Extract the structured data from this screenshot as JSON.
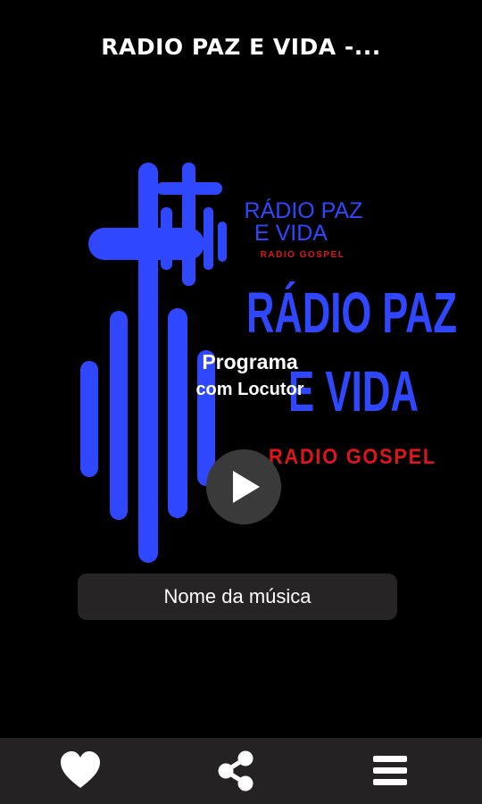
{
  "header": {
    "title": "RADIO PAZ E VIDA -..."
  },
  "logo": {
    "line1": "RÁDIO PAZ",
    "line2": "E VIDA",
    "tagline_small": "RADIO GOSPEL",
    "big_line1": "RÁDIO PAZ",
    "big_line2": "E VIDA",
    "tagline_big": "RADIO GOSPEL",
    "colors": {
      "brand_blue": "#2f47ff",
      "gospel_red": "#e0141b"
    }
  },
  "program": {
    "line1": "Programa",
    "line2": "com Locutor"
  },
  "player": {
    "play_icon": "play-icon",
    "song_name": "Nome da música"
  },
  "bottom_nav": {
    "items": [
      {
        "icon": "heart-icon"
      },
      {
        "icon": "share-icon"
      },
      {
        "icon": "menu-icon"
      }
    ]
  }
}
